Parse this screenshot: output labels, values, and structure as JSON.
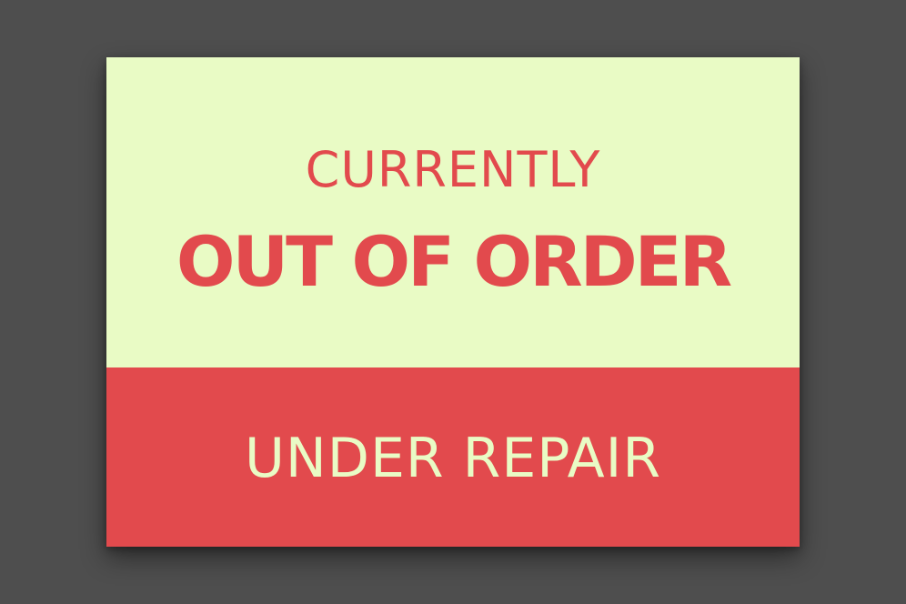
{
  "colors": {
    "background": "#4e4e4e",
    "sign_light": "#e9fbc5",
    "sign_red": "#e24a4d"
  },
  "sign": {
    "line1": "CURRENTLY",
    "line2": "OUT OF ORDER",
    "line3": "UNDER REPAIR"
  }
}
